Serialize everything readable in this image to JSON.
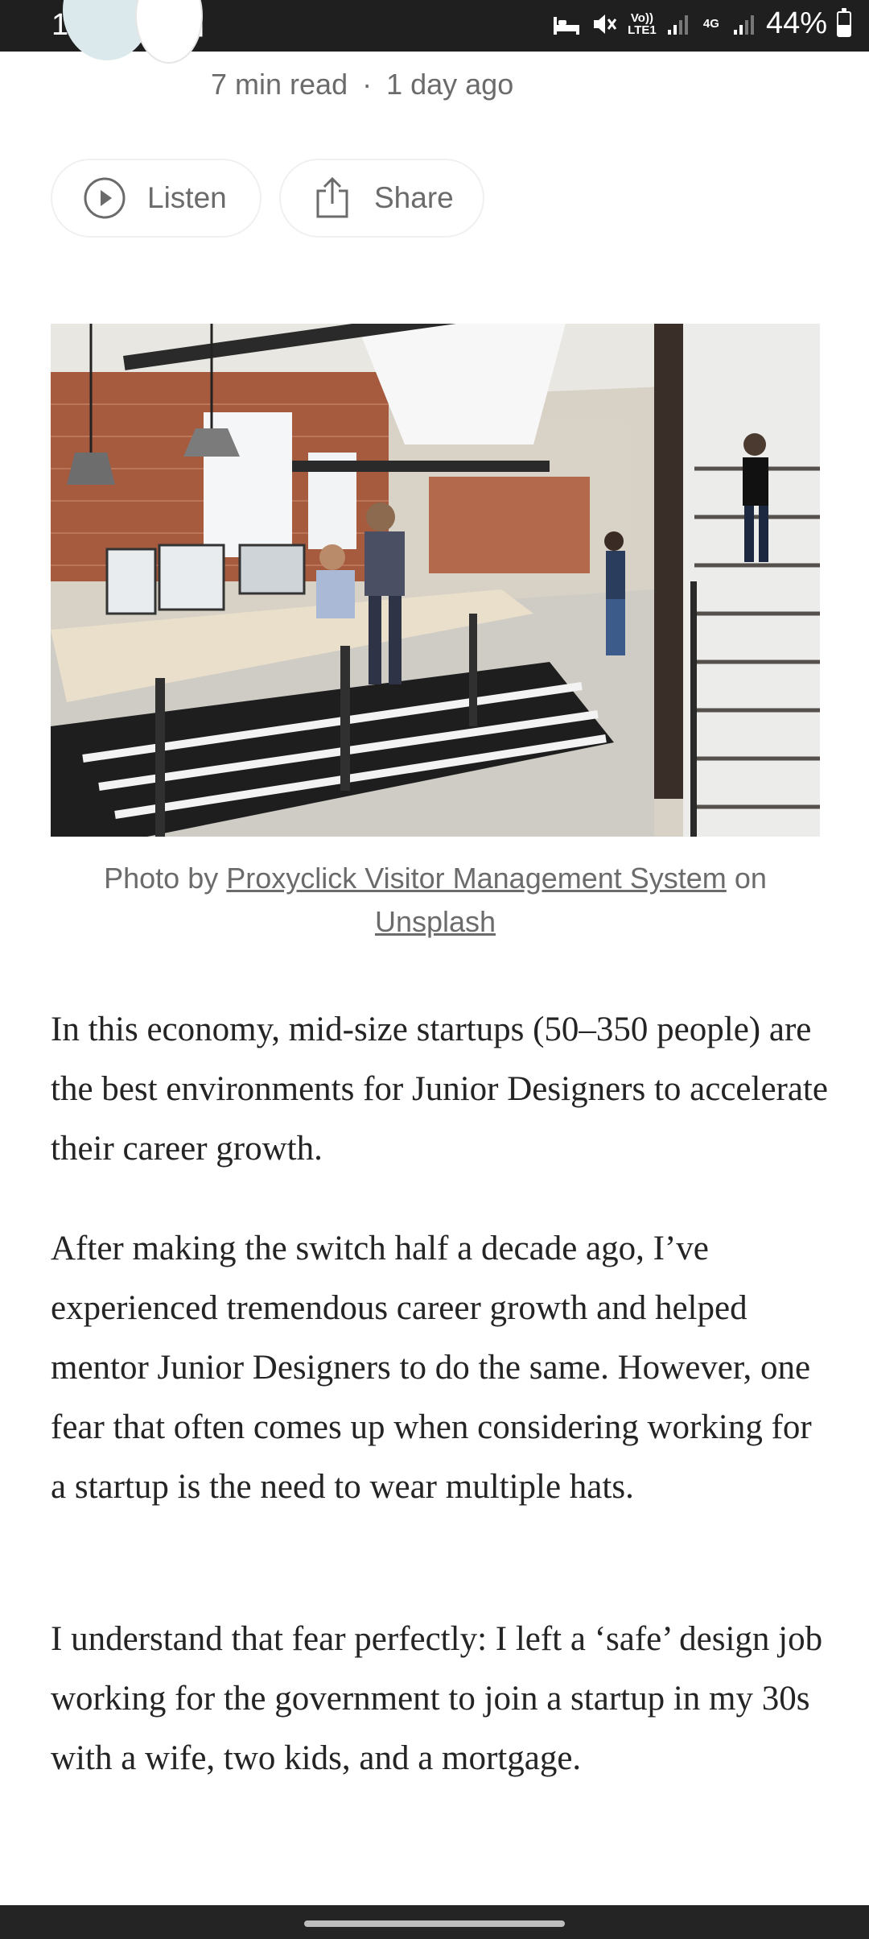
{
  "status_bar": {
    "time": "14:26",
    "left_icons": [
      "missed-call-icon",
      "sim-card-icon"
    ],
    "right_icons": [
      "bed-icon",
      "mute-icon",
      "volte-icon",
      "signal-icon",
      "4g-icon",
      "signal-icon"
    ],
    "volte_label": "Vo)) LTE1",
    "network_label": "4G",
    "battery": "44%",
    "battery_level": 0.44
  },
  "article_meta": {
    "read_time": "7 min read",
    "separator": "·",
    "published": "1 day ago"
  },
  "actions": {
    "listen_label": "Listen",
    "share_label": "Share"
  },
  "image_caption": {
    "prefix": "Photo by",
    "author_link": "Proxyclick Visitor Management System",
    "middle": "on",
    "source_link": "Unsplash"
  },
  "paragraphs": [
    "In this economy, mid-size startups (50–350 people) are the best environments for Junior Designers to accelerate their career growth.",
    "After making the switch half a decade ago, I’ve experienced tremendous career growth and helped mentor Junior Designers to do the same. However, one fear that often comes up when considering working for a startup is the need to wear multiple hats.",
    "I understand that fear perfectly: I left a ‘safe’ design job working for the government to join a startup in my 30s with a wife, two kids, and a mortgage."
  ],
  "colors": {
    "text": "#242424",
    "muted": "#6b6b6b",
    "status_bar": "#1f1f1f"
  }
}
